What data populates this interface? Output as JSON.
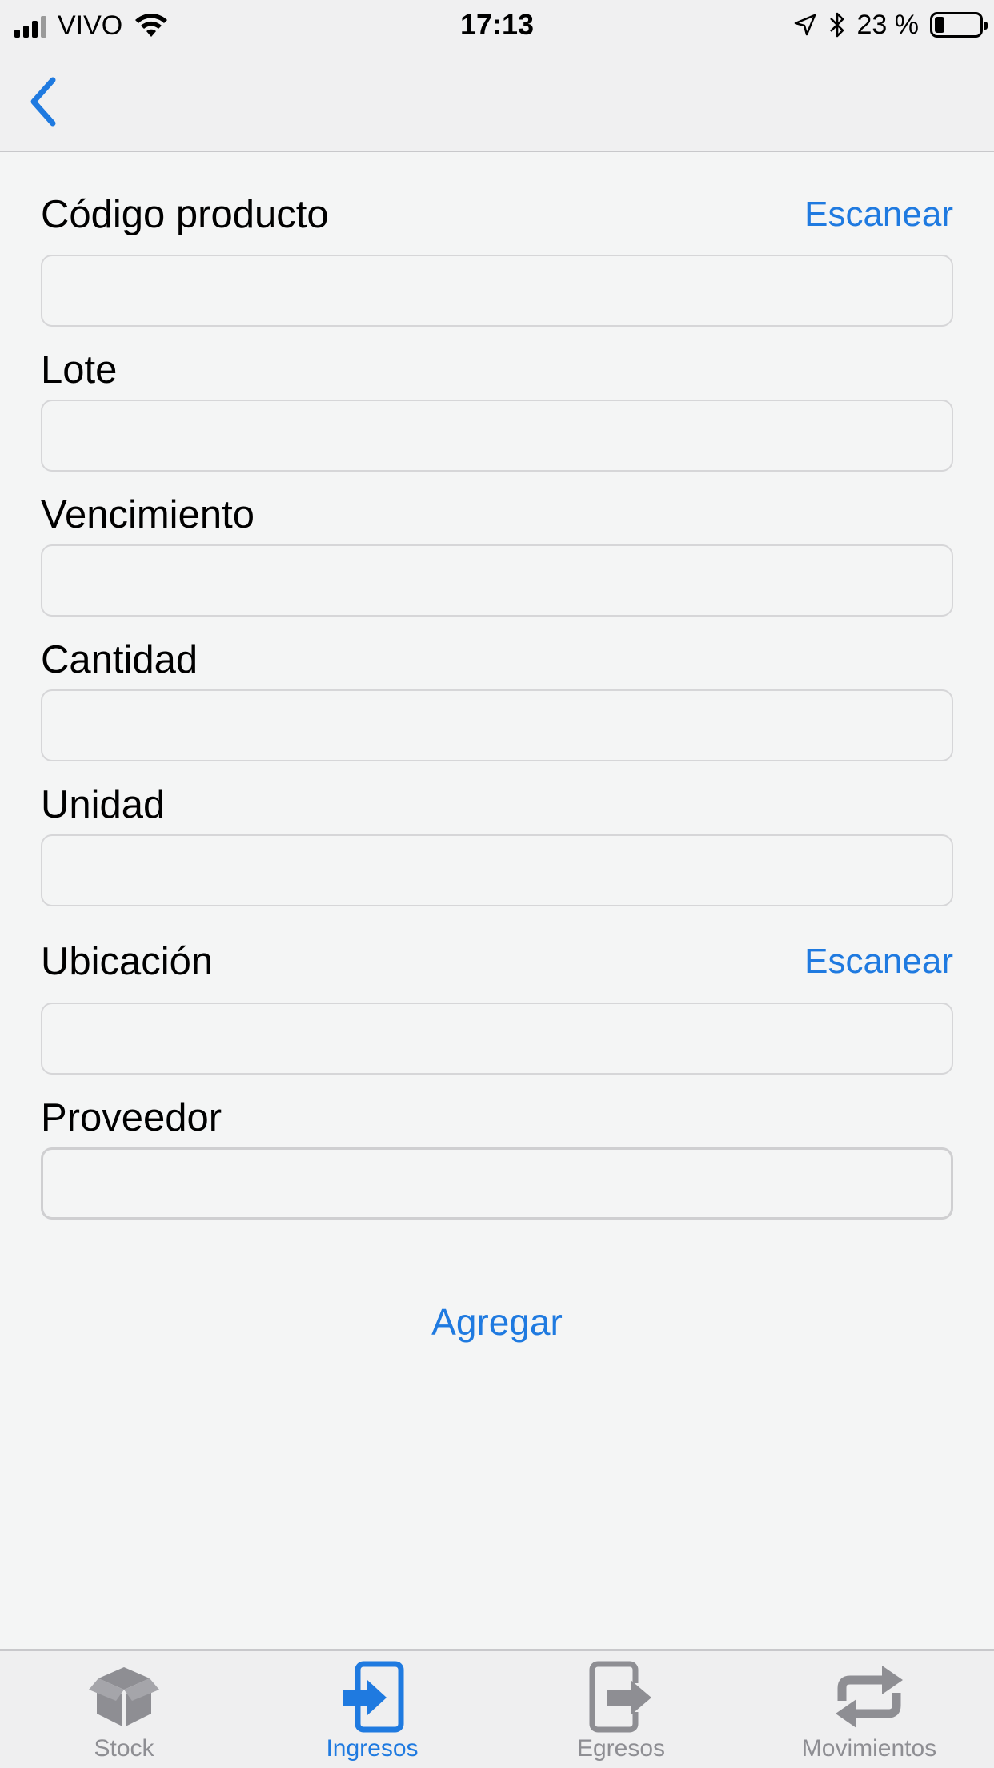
{
  "status_bar": {
    "carrier": "VIVO",
    "time": "17:13",
    "battery_percent": "23 %",
    "battery_level": 0.23,
    "icons": [
      "signal-icon",
      "wifi-icon",
      "location-arrow-icon",
      "bluetooth-icon",
      "battery-icon"
    ]
  },
  "nav": {
    "back_icon": "chevron-left-icon"
  },
  "form": {
    "fields": [
      {
        "label": "Código producto",
        "value": "",
        "action": "Escanear"
      },
      {
        "label": "Lote",
        "value": ""
      },
      {
        "label": "Vencimiento",
        "value": ""
      },
      {
        "label": "Cantidad",
        "value": ""
      },
      {
        "label": "Unidad",
        "value": ""
      },
      {
        "label": "Ubicación",
        "value": "",
        "action": "Escanear"
      },
      {
        "label": "Proveedor",
        "value": ""
      }
    ],
    "submit_label": "Agregar"
  },
  "tab_bar": {
    "active": "Ingresos",
    "items": [
      {
        "label": "Stock",
        "icon": "box-icon"
      },
      {
        "label": "Ingresos",
        "icon": "sign-in-icon"
      },
      {
        "label": "Egresos",
        "icon": "sign-out-icon"
      },
      {
        "label": "Movimientos",
        "icon": "repeat-arrows-icon"
      }
    ]
  },
  "colors": {
    "accent": "#1f7ae0",
    "inactive": "#8e8e93",
    "background": "#f4f5f5"
  }
}
